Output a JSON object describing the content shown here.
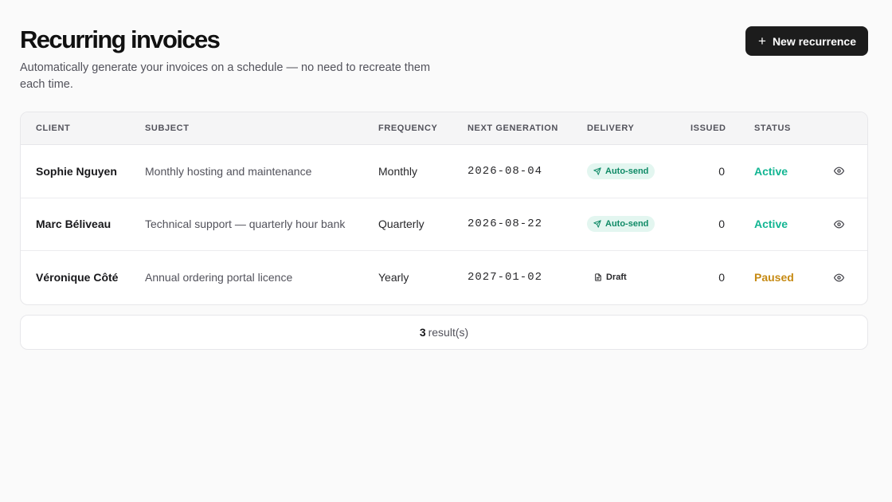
{
  "header": {
    "title": "Recurring invoices",
    "subtitle": "Automatically generate your invoices on a schedule — no need to recreate them each time.",
    "new_button_label": "New recurrence",
    "new_button_icon": "plus-icon"
  },
  "table": {
    "columns": {
      "client": "CLIENT",
      "subject": "SUBJECT",
      "frequency": "FREQUENCY",
      "next_generation": "NEXT GENERATION",
      "delivery": "DELIVERY",
      "issued": "ISSUED",
      "status": "STATUS"
    },
    "rows": [
      {
        "client": "Sophie Nguyen",
        "subject": "Monthly hosting and maintenance",
        "frequency": "Monthly",
        "next_generation": "2026-08-04",
        "delivery": "Auto-send",
        "delivery_icon": "send-icon",
        "issued": "0",
        "status": "Active",
        "row_icon": "eye-icon"
      },
      {
        "client": "Marc Béliveau",
        "subject": "Technical support — quarterly hour bank",
        "frequency": "Quarterly",
        "next_generation": "2026-08-22",
        "delivery": "Auto-send",
        "delivery_icon": "send-icon",
        "issued": "0",
        "status": "Active",
        "row_icon": "eye-icon"
      },
      {
        "client": "Véronique Côté",
        "subject": "Annual ordering portal licence",
        "frequency": "Yearly",
        "next_generation": "2027-01-02",
        "delivery": "Draft",
        "delivery_icon": "document-icon",
        "issued": "0",
        "status": "Paused",
        "row_icon": "eye-icon"
      }
    ]
  },
  "footer": {
    "count": "3",
    "label": "result(s)"
  },
  "colors": {
    "accent_active": "#12b592",
    "accent_paused": "#c68a13",
    "auto_badge_bg": "#e3f6f0",
    "auto_badge_text": "#0f8a66",
    "button_bg": "#1c1c1c"
  }
}
